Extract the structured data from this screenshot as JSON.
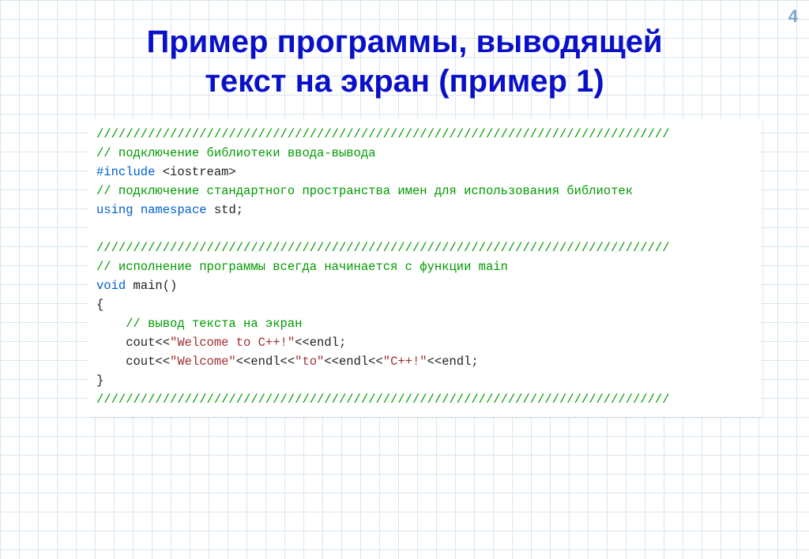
{
  "page_number": "4",
  "title_line1": "Пример программы, выводящей",
  "title_line2": "текст на экран (пример 1)",
  "code": {
    "hr1": "//////////////////////////////////////////////////////////////////////////////",
    "c_io": "// подключение библиотеки ввода-вывода",
    "include_kw": "#include",
    "include_hdr": " <iostream>",
    "c_ns": "// подключение стандартного пространства имен для использования библиотек",
    "using_kw": "using",
    "namespace_kw": "namespace",
    "std_id": " std;",
    "hr2": "//////////////////////////////////////////////////////////////////////////////",
    "c_main": "// исполнение программы всегда начинается с функции main",
    "void_kw": "void",
    "main_sig": " main()",
    "brace_open": "{",
    "c_out": "    // вывод текста на экран",
    "line1_a": "    cout<<",
    "line1_s": "\"Welcome to C++!\"",
    "line1_b": "<<endl;",
    "line2_a": "    cout<<",
    "line2_s1": "\"Welcome\"",
    "line2_m1": "<<endl<<",
    "line2_s2": "\"to\"",
    "line2_m2": "<<endl<<",
    "line2_s3": "\"C++!\"",
    "line2_b": "<<endl;",
    "brace_close": "}",
    "hr3": "//////////////////////////////////////////////////////////////////////////////"
  }
}
